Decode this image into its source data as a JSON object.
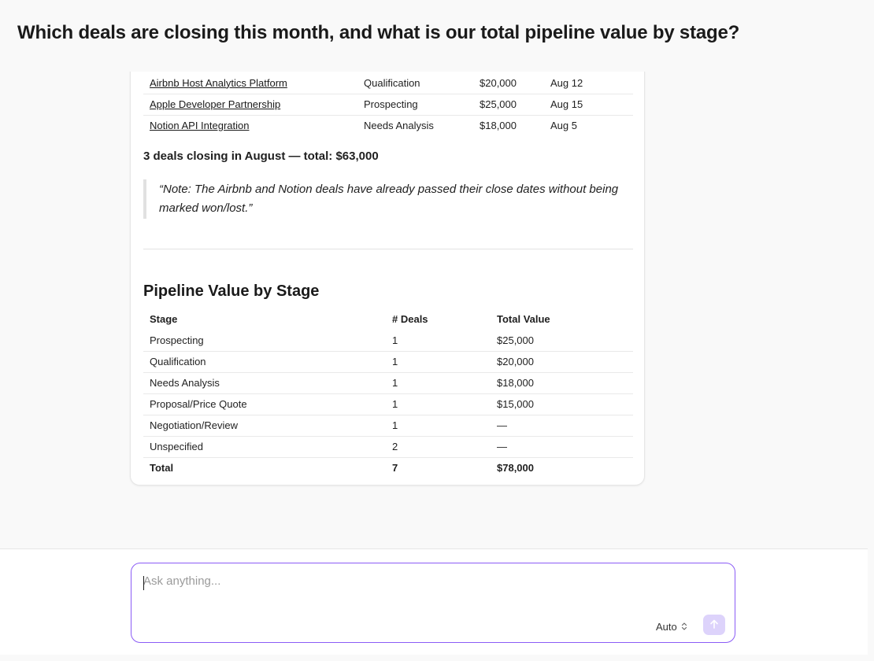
{
  "question": "Which deals are closing this month, and what is our total pipeline value by stage?",
  "deals_table": {
    "rows": [
      {
        "name": "Airbnb Host Analytics Platform",
        "stage": "Qualification",
        "value": "$20,000",
        "close": "Aug 12"
      },
      {
        "name": "Apple Developer Partnership",
        "stage": "Prospecting",
        "value": "$25,000",
        "close": "Aug 15"
      },
      {
        "name": "Notion API Integration",
        "stage": "Needs Analysis",
        "value": "$18,000",
        "close": "Aug 5"
      }
    ]
  },
  "summary": "3 deals closing in August — total: $63,000",
  "note": "“Note: The Airbnb and Notion deals have already passed their close dates without being marked won/lost.”",
  "pipeline": {
    "heading": "Pipeline Value by Stage",
    "headers": [
      "Stage",
      "# Deals",
      "Total Value"
    ],
    "rows": [
      [
        "Prospecting",
        "1",
        "$25,000"
      ],
      [
        "Qualification",
        "1",
        "$20,000"
      ],
      [
        "Needs Analysis",
        "1",
        "$18,000"
      ],
      [
        "Proposal/Price Quote",
        "1",
        "$15,000"
      ],
      [
        "Negotiation/Review",
        "1",
        "—"
      ],
      [
        "Unspecified",
        "2",
        "—"
      ]
    ],
    "total": [
      "Total",
      "7",
      "$78,000"
    ]
  },
  "composer": {
    "placeholder": "Ask anything...",
    "mode": "Auto",
    "accent_color": "#8b5cf6",
    "send_icon": "arrow-up-icon",
    "mode_icon": "chevron-up-down-icon"
  }
}
